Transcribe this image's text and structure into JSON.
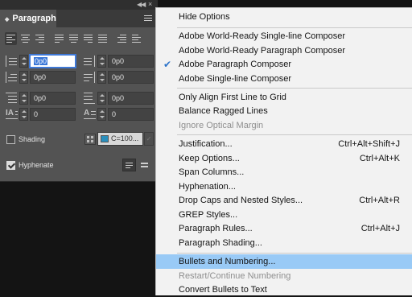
{
  "panel": {
    "tab_label": "Paragraph",
    "alignment_buttons": [
      "align-left",
      "align-center",
      "align-right",
      "justify-left",
      "justify-center",
      "justify-right",
      "justify-all",
      "align-towards-spine",
      "align-away-from-spine"
    ],
    "fields": {
      "left_indent": "0p0",
      "right_indent": "0p0",
      "first_line_indent": "0p0",
      "last_line_indent": "0p0",
      "space_before": "0p0",
      "space_after": "0p0",
      "drop_cap_lines": "0",
      "drop_cap_chars": "0"
    },
    "shading_label": "Shading",
    "shading_checked": false,
    "shading_swatch": "C=100...",
    "shading_swatch_color": "#2a8fbd",
    "hyphenate_label": "Hyphenate",
    "hyphenate_checked": true
  },
  "menu": {
    "items": [
      {
        "label": "Hide Options",
        "shortcut": "",
        "disabled": false,
        "checked": false,
        "highlighted": false
      },
      {
        "label": "Adobe World-Ready Single-line Composer",
        "shortcut": "",
        "disabled": false,
        "checked": false,
        "highlighted": false
      },
      {
        "label": "Adobe World-Ready Paragraph Composer",
        "shortcut": "",
        "disabled": false,
        "checked": false,
        "highlighted": false
      },
      {
        "label": "Adobe Paragraph Composer",
        "shortcut": "",
        "disabled": false,
        "checked": true,
        "highlighted": false
      },
      {
        "label": "Adobe Single-line Composer",
        "shortcut": "",
        "disabled": false,
        "checked": false,
        "highlighted": false
      },
      {
        "label": "Only Align First Line to Grid",
        "shortcut": "",
        "disabled": false,
        "checked": false,
        "highlighted": false
      },
      {
        "label": "Balance Ragged Lines",
        "shortcut": "",
        "disabled": false,
        "checked": false,
        "highlighted": false
      },
      {
        "label": "Ignore Optical Margin",
        "shortcut": "",
        "disabled": true,
        "checked": false,
        "highlighted": false
      },
      {
        "label": "Justification...",
        "shortcut": "Ctrl+Alt+Shift+J",
        "disabled": false,
        "checked": false,
        "highlighted": false
      },
      {
        "label": "Keep Options...",
        "shortcut": "Ctrl+Alt+K",
        "disabled": false,
        "checked": false,
        "highlighted": false
      },
      {
        "label": "Span Columns...",
        "shortcut": "",
        "disabled": false,
        "checked": false,
        "highlighted": false
      },
      {
        "label": "Hyphenation...",
        "shortcut": "",
        "disabled": false,
        "checked": false,
        "highlighted": false
      },
      {
        "label": "Drop Caps and Nested Styles...",
        "shortcut": "Ctrl+Alt+R",
        "disabled": false,
        "checked": false,
        "highlighted": false
      },
      {
        "label": "GREP Styles...",
        "shortcut": "",
        "disabled": false,
        "checked": false,
        "highlighted": false
      },
      {
        "label": "Paragraph Rules...",
        "shortcut": "Ctrl+Alt+J",
        "disabled": false,
        "checked": false,
        "highlighted": false
      },
      {
        "label": "Paragraph Shading...",
        "shortcut": "",
        "disabled": false,
        "checked": false,
        "highlighted": false
      },
      {
        "label": "Bullets and Numbering...",
        "shortcut": "",
        "disabled": false,
        "checked": false,
        "highlighted": true
      },
      {
        "label": "Restart/Continue Numbering",
        "shortcut": "",
        "disabled": true,
        "checked": false,
        "highlighted": false
      },
      {
        "label": "Convert Bullets to Text",
        "shortcut": "",
        "disabled": false,
        "checked": false,
        "highlighted": false
      }
    ]
  },
  "colors": {
    "panel_bg": "#535353",
    "menu_bg": "#f2f2f2",
    "menu_highlight": "#99caf6",
    "check_color": "#2a72c9",
    "field_focus": "#3e78d6"
  }
}
